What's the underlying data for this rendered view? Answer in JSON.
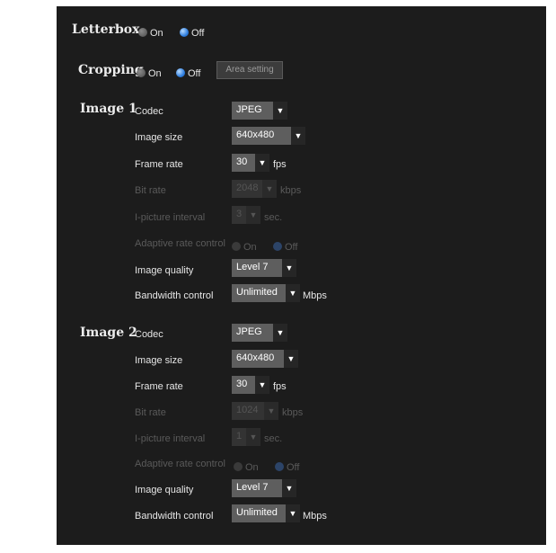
{
  "letterbox": {
    "label": "Letterbox",
    "on": "On",
    "off": "Off",
    "selected": "Off"
  },
  "cropping": {
    "label": "Cropping",
    "on": "On",
    "off": "Off",
    "selected": "Off",
    "area_button": "Area setting"
  },
  "image1": {
    "title": "Image 1",
    "codec": {
      "label": "Codec",
      "value": "JPEG"
    },
    "image_size": {
      "label": "Image size",
      "value": "640x480"
    },
    "frame_rate": {
      "label": "Frame rate",
      "value": "30",
      "unit": "fps"
    },
    "bit_rate": {
      "label": "Bit rate",
      "value": "2048",
      "unit": "kbps"
    },
    "ipicture": {
      "label": "I-picture interval",
      "value": "3",
      "unit": "sec."
    },
    "adaptive": {
      "label": "Adaptive rate control",
      "on": "On",
      "off": "Off",
      "selected": "Off"
    },
    "quality": {
      "label": "Image quality",
      "value": "Level 7"
    },
    "bandwidth": {
      "label": "Bandwidth control",
      "value": "Unlimited",
      "unit": "Mbps"
    }
  },
  "image2": {
    "title": "Image 2",
    "codec": {
      "label": "Codec",
      "value": "JPEG"
    },
    "image_size": {
      "label": "Image size",
      "value": "640x480"
    },
    "frame_rate": {
      "label": "Frame rate",
      "value": "30",
      "unit": "fps"
    },
    "bit_rate": {
      "label": "Bit rate",
      "value": "1024",
      "unit": "kbps"
    },
    "ipicture": {
      "label": "I-picture interval",
      "value": "1",
      "unit": "sec."
    },
    "adaptive": {
      "label": "Adaptive rate control",
      "on": "On",
      "off": "Off",
      "selected": "Off"
    },
    "quality": {
      "label": "Image quality",
      "value": "Level 7"
    },
    "bandwidth": {
      "label": "Bandwidth control",
      "value": "Unlimited",
      "unit": "Mbps"
    }
  },
  "icons": {
    "dropdown": "triangle-down-icon"
  }
}
